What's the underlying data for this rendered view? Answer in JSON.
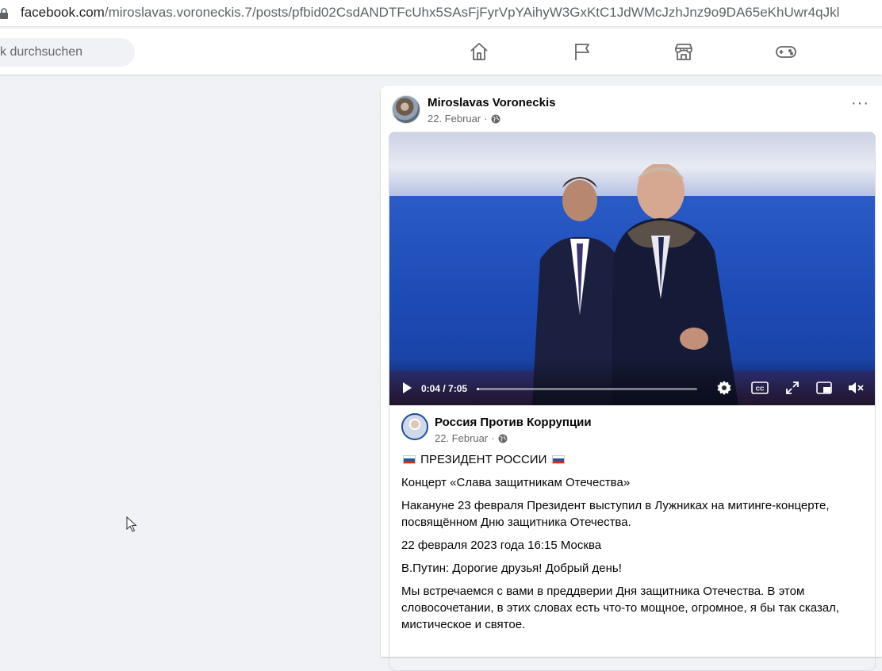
{
  "browser": {
    "url_host": "facebook.com",
    "url_path": "/miroslavas.voroneckis.7/posts/pfbid02CsdANDTFcUhx5SAsFjFyrVpYAihyW3GxKtC1JdWMcJzhJnz9o9DA65eKhUwr4qJkl"
  },
  "nav": {
    "search_placeholder": "k durchsuchen",
    "icons": [
      "home-icon",
      "pages-flag-icon",
      "marketplace-icon",
      "gaming-icon"
    ]
  },
  "post": {
    "author": "Miroslavas Voroneckis",
    "date": "22. Februar",
    "separator": "·",
    "more_menu": "···"
  },
  "video": {
    "time": "0:04 / 7:05",
    "progress": 0.01
  },
  "shared": {
    "author": "Россия Против Коррупции",
    "date": "22. Februar",
    "separator": "·",
    "headline": "ПРЕЗИДЕНТ РОССИИ",
    "paragraphs": [
      "Концерт «Слава защитникам Отечества»",
      "Накануне 23 февраля Президент выступил в Лужниках на митинге-концерте, посвящённом Дню защитника Отечества.",
      "22 февраля 2023 года 16:15 Москва",
      "В.Путин: Дорогие друзья! Добрый день!",
      "Мы встречаемся с вами в преддверии Дня защитника Отечества. В этом словосочетании, в этих словах есть что-то мощное, огромное, я бы так сказал, мистическое и святое."
    ]
  },
  "colors": {
    "fb_bg": "#f0f2f5",
    "text_secondary": "#65676b",
    "flag_blue": "#1c57a5",
    "flag_red": "#d52b1e"
  }
}
